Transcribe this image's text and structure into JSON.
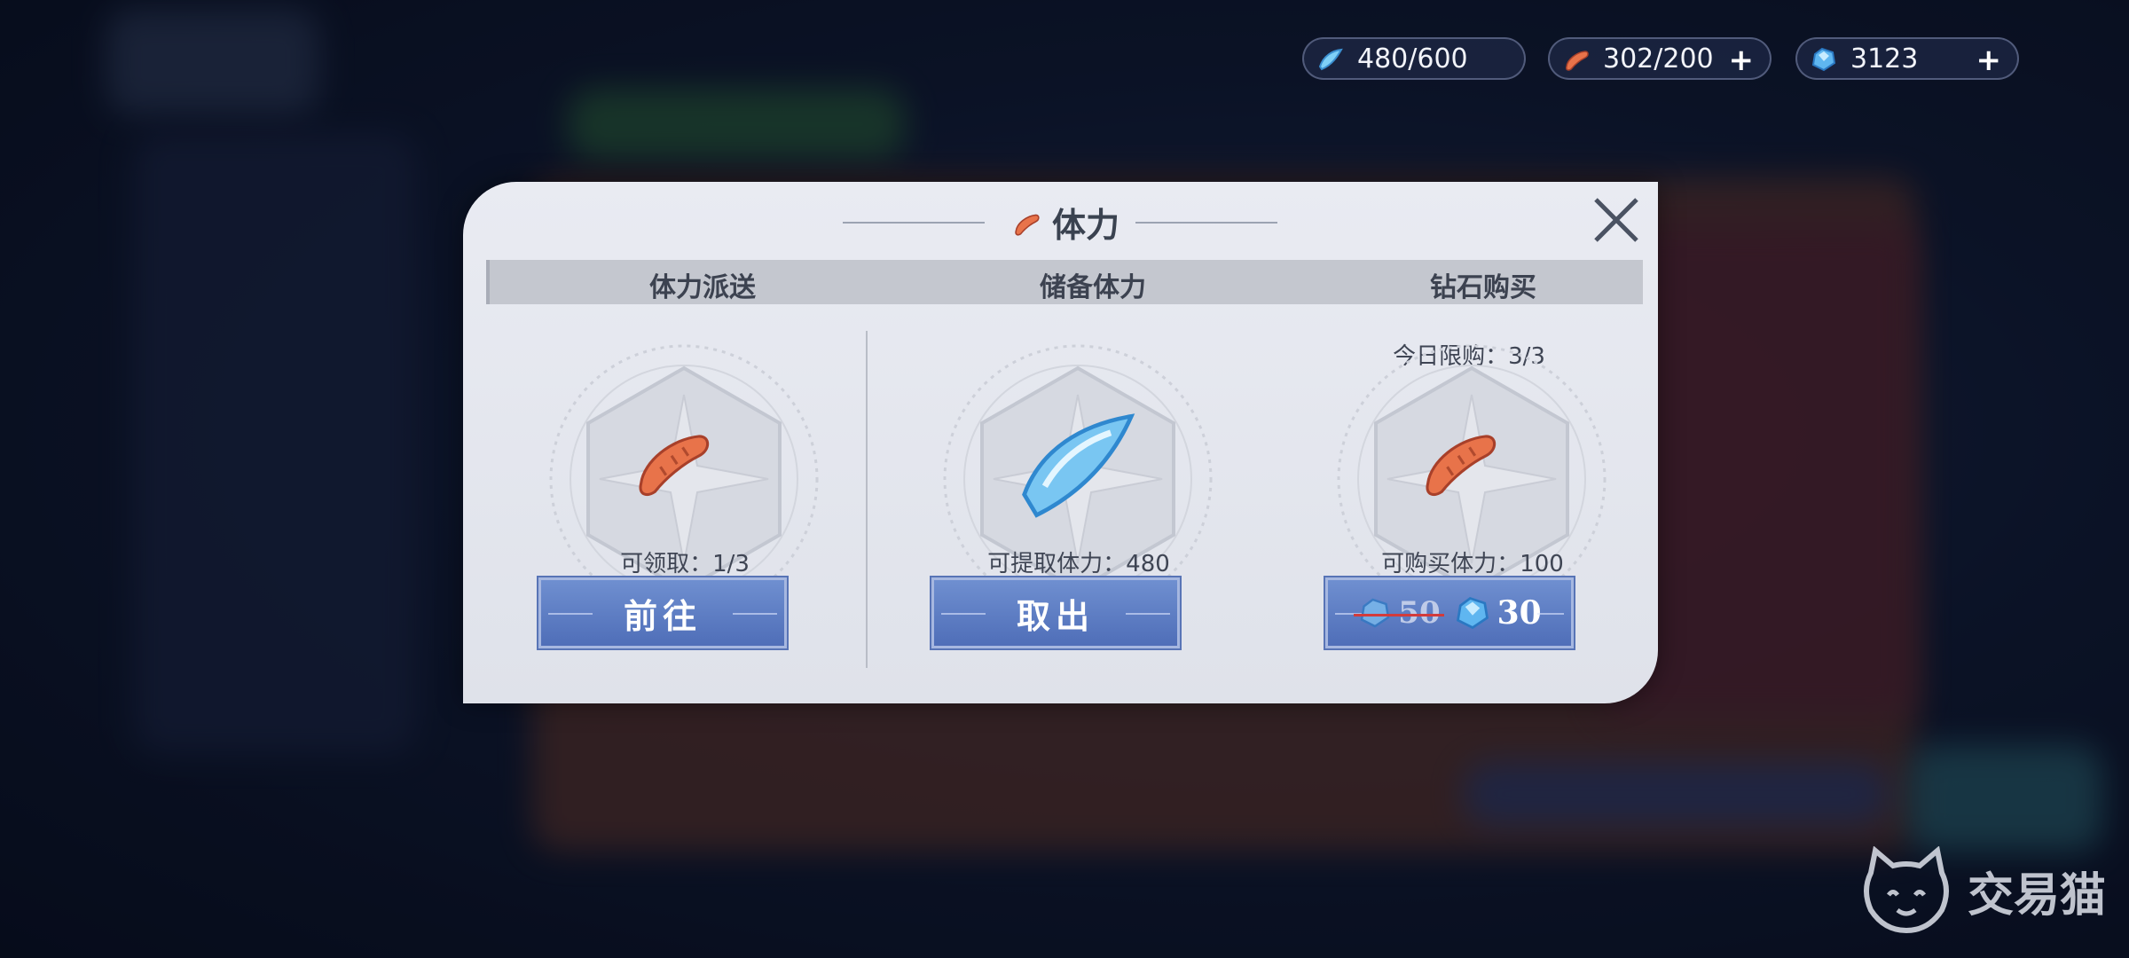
{
  "resources": [
    {
      "icon": "blue-crystal-icon",
      "value": "480/600",
      "has_plus": false
    },
    {
      "icon": "sausage-icon",
      "value": "302/200",
      "has_plus": true
    },
    {
      "icon": "diamond-icon",
      "value": "3123",
      "has_plus": true
    }
  ],
  "dialog": {
    "title": "体力",
    "columns": [
      {
        "header": "体力派送",
        "top_note": "",
        "hint": "可领取：1/3",
        "button": "前往",
        "item_icon": "sausage-icon"
      },
      {
        "header": "储备体力",
        "top_note": "",
        "hint": "可提取体力：480",
        "button": "取出",
        "item_icon": "blue-crystal-icon"
      },
      {
        "header": "钻石购买",
        "top_note": "今日限购：3/3",
        "hint": "可购买体力：100",
        "old_price": "50",
        "new_price": "30",
        "item_icon": "sausage-icon"
      }
    ]
  },
  "watermark": "交易猫",
  "colors": {
    "button_blue": "#5a78c0",
    "strike_red": "#d23b3b",
    "sausage": "#e8734a",
    "crystal": "#79c6f2"
  }
}
